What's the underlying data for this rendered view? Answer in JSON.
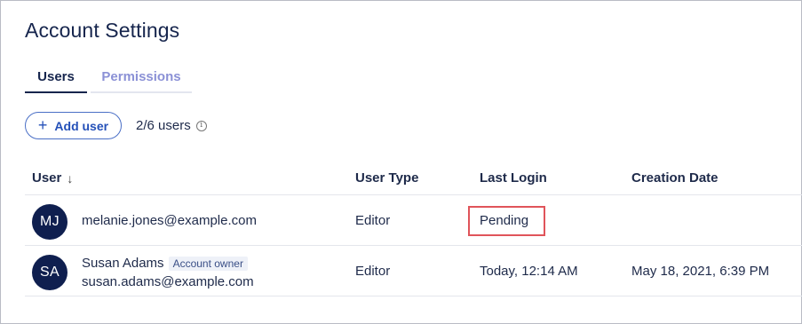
{
  "page": {
    "title": "Account Settings"
  },
  "tabs": [
    {
      "label": "Users",
      "active": true
    },
    {
      "label": "Permissions",
      "active": false
    }
  ],
  "toolbar": {
    "add_user_label": "Add user",
    "user_count": "2/6 users"
  },
  "table": {
    "columns": [
      "User",
      "User Type",
      "Last Login",
      "Creation Date"
    ],
    "rows": [
      {
        "initials": "MJ",
        "name": "",
        "email": "melanie.jones@example.com",
        "badge": "",
        "user_type": "Editor",
        "last_login": "Pending",
        "creation_date": ""
      },
      {
        "initials": "SA",
        "name": "Susan Adams",
        "email": "susan.adams@example.com",
        "badge": "Account owner",
        "user_type": "Editor",
        "last_login": "Today, 12:14 AM",
        "creation_date": "May 18, 2021, 6:39 PM"
      }
    ]
  },
  "icons": {
    "add": "plus-icon",
    "info": "info-icon",
    "sort": "arrow-down-icon"
  },
  "colors": {
    "primary_text": "#16254d",
    "accent": "#2450b8",
    "inactive_tab": "#8b91d6",
    "avatar_bg": "#0f1f4f",
    "highlight_border": "#e0545a"
  }
}
